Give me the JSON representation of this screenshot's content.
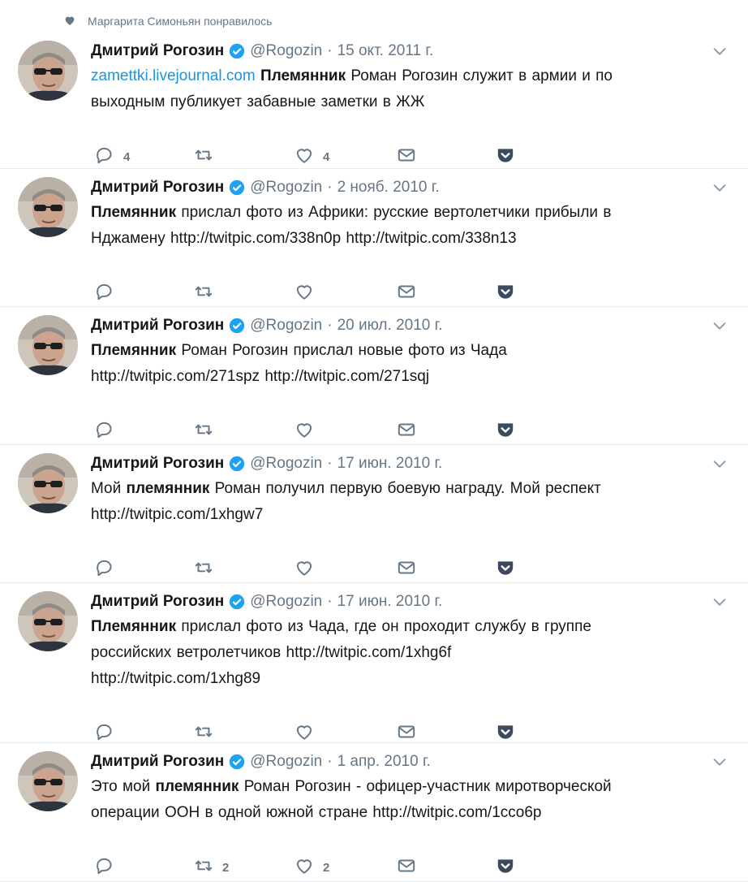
{
  "liked_by": "Маргарита Симоньян понравилось",
  "colors": {
    "accent": "#1b95e0",
    "muted": "#657786",
    "text": "#14171a",
    "border": "#e6ecf0"
  },
  "tweets": [
    {
      "author_name": "Дмитрий Рогозин",
      "handle": "@Rogozin",
      "separator": "·",
      "date": "15 окт. 2011 г.",
      "line1": [
        {
          "t": "zamettki.livejournal.com",
          "s": "link"
        },
        {
          "t": " "
        },
        {
          "t": "Племянник",
          "s": "b"
        },
        {
          "t": " Роман Рогозин служит в армии и по"
        }
      ],
      "line2": [
        {
          "t": "выходным публикует забавные заметки в ЖЖ"
        }
      ],
      "line3": [],
      "replies": "4",
      "retweets": "",
      "likes": "4"
    },
    {
      "author_name": "Дмитрий Рогозин",
      "handle": "@Rogozin",
      "separator": "·",
      "date": "2 нояб. 2010 г.",
      "line1": [
        {
          "t": "Племянник",
          "s": "b"
        },
        {
          "t": " прислал фото из Африки: русские вертолетчики прибыли в"
        }
      ],
      "line2": [
        {
          "t": "Нджамену http://twitpic.com/338n0p http://twitpic.com/338n13"
        }
      ],
      "line3": [],
      "replies": "",
      "retweets": "",
      "likes": ""
    },
    {
      "author_name": "Дмитрий Рогозин",
      "handle": "@Rogozin",
      "separator": "·",
      "date": "20 июл. 2010 г.",
      "line1": [
        {
          "t": "Племянник",
          "s": "b"
        },
        {
          "t": " Роман Рогозин прислал новые фото из Чада"
        }
      ],
      "line2": [
        {
          "t": "http://twitpic.com/271spz http://twitpic.com/271sqj"
        }
      ],
      "line3": [],
      "replies": "",
      "retweets": "",
      "likes": ""
    },
    {
      "author_name": "Дмитрий Рогозин",
      "handle": "@Rogozin",
      "separator": "·",
      "date": "17 июн. 2010 г.",
      "line1": [
        {
          "t": "Мой "
        },
        {
          "t": "племянник",
          "s": "b"
        },
        {
          "t": " Роман получил первую боевую награду. Мой респект"
        }
      ],
      "line2": [
        {
          "t": "http://twitpic.com/1xhgw7"
        }
      ],
      "line3": [],
      "replies": "",
      "retweets": "",
      "likes": ""
    },
    {
      "author_name": "Дмитрий Рогозин",
      "handle": "@Rogozin",
      "separator": "·",
      "date": "17 июн. 2010 г.",
      "line1": [
        {
          "t": "Племянник",
          "s": "b"
        },
        {
          "t": " прислал фото из Чада, где он проходит службу в группе"
        }
      ],
      "line2": [
        {
          "t": "российских ветролетчиков http://twitpic.com/1xhg6f"
        }
      ],
      "line3": [
        {
          "t": "http://twitpic.com/1xhg89"
        }
      ],
      "replies": "",
      "retweets": "",
      "likes": ""
    },
    {
      "author_name": "Дмитрий Рогозин",
      "handle": "@Rogozin",
      "separator": "·",
      "date": "1 апр. 2010 г.",
      "line1": [
        {
          "t": "Это мой "
        },
        {
          "t": "племянник",
          "s": "b"
        },
        {
          "t": " Роман Рогозин - офицер-участник миротворческой"
        }
      ],
      "line2": [
        {
          "t": "операции ООН в одной южной стране http://twitpic.com/1cco6p"
        }
      ],
      "line3": [],
      "replies": "",
      "retweets": "2",
      "likes": "2"
    }
  ]
}
